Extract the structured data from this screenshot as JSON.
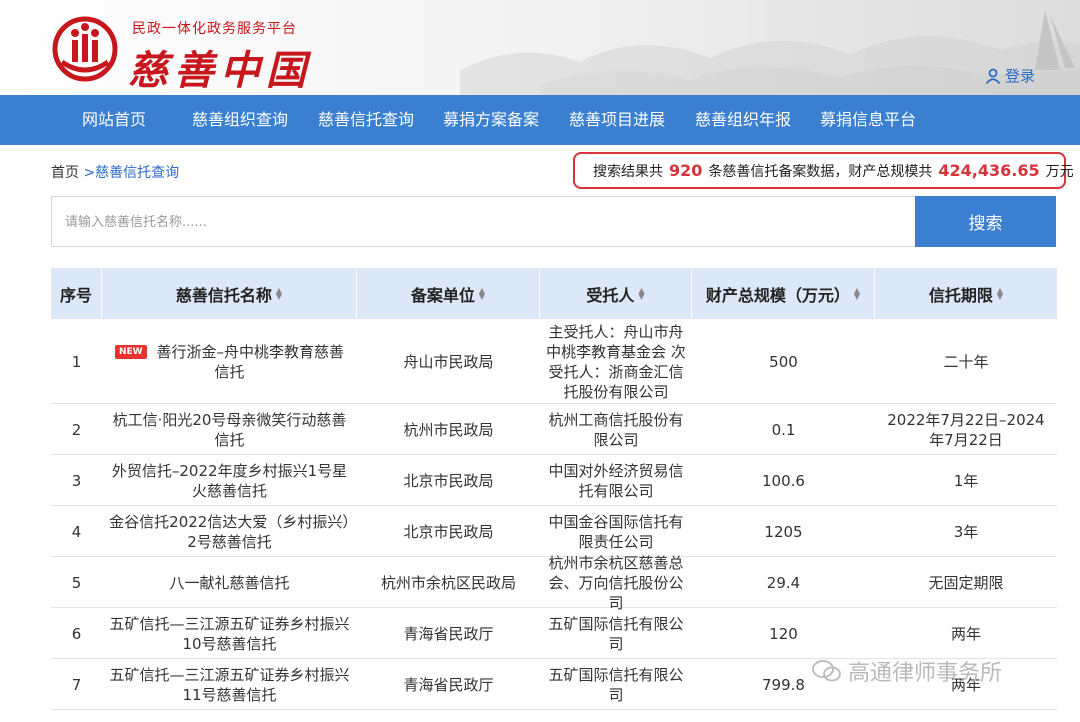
{
  "header": {
    "platform": "民政一体化政务服务平台",
    "brand": "慈善中国",
    "login": "登录"
  },
  "nav": [
    "网站首页",
    "慈善组织查询",
    "慈善信托查询",
    "募捐方案备案",
    "慈善项目进展",
    "慈善组织年报",
    "募捐信息平台"
  ],
  "breadcrumb": {
    "home": "首页",
    "current": ">慈善信托查询"
  },
  "summary": {
    "prefix": "搜索结果共",
    "count": "920",
    "middle": "条慈善信托备案数据，财产总规模共",
    "total": "424,436.65",
    "unit": "万元"
  },
  "search": {
    "placeholder": "请输入慈善信托名称......",
    "button": "搜索"
  },
  "table": {
    "columns": [
      "序号",
      "慈善信托名称",
      "备案单位",
      "受托人",
      "财产总规模（万元）",
      "信托期限"
    ],
    "badge": "NEW",
    "rows": [
      {
        "no": "1",
        "name": "善行浙金–舟中桃李教育慈善信托",
        "unit": "舟山市民政局",
        "trustee": "主受托人：舟山市舟中桃李教育基金会 次受托人：浙商金汇信托股份有限公司",
        "scale": "500",
        "term": "二十年"
      },
      {
        "no": "2",
        "name": "杭工信·阳光20号母亲微笑行动慈善信托",
        "unit": "杭州市民政局",
        "trustee": "杭州工商信托股份有限公司",
        "scale": "0.1",
        "term": "2022年7月22日–2024年7月22日"
      },
      {
        "no": "3",
        "name": "外贸信托–2022年度乡村振兴1号星火慈善信托",
        "unit": "北京市民政局",
        "trustee": "中国对外经济贸易信托有限公司",
        "scale": "100.6",
        "term": "1年"
      },
      {
        "no": "4",
        "name": "金谷信托2022信达大爱（乡村振兴）2号慈善信托",
        "unit": "北京市民政局",
        "trustee": "中国金谷国际信托有限责任公司",
        "scale": "1205",
        "term": "3年"
      },
      {
        "no": "5",
        "name": "八一献礼慈善信托",
        "unit": "杭州市余杭区民政局",
        "trustee": "杭州市余杭区慈善总会、万向信托股份公司",
        "scale": "29.4",
        "term": "无固定期限"
      },
      {
        "no": "6",
        "name": "五矿信托—三江源五矿证券乡村振兴10号慈善信托",
        "unit": "青海省民政厅",
        "trustee": "五矿国际信托有限公司",
        "scale": "120",
        "term": "两年"
      },
      {
        "no": "7",
        "name": "五矿信托—三江源五矿证券乡村振兴11号慈善信托",
        "unit": "青海省民政厅",
        "trustee": "五矿国际信托有限公司",
        "scale": "799.8",
        "term": "两年"
      }
    ]
  },
  "watermark": "高通律师事务所"
}
